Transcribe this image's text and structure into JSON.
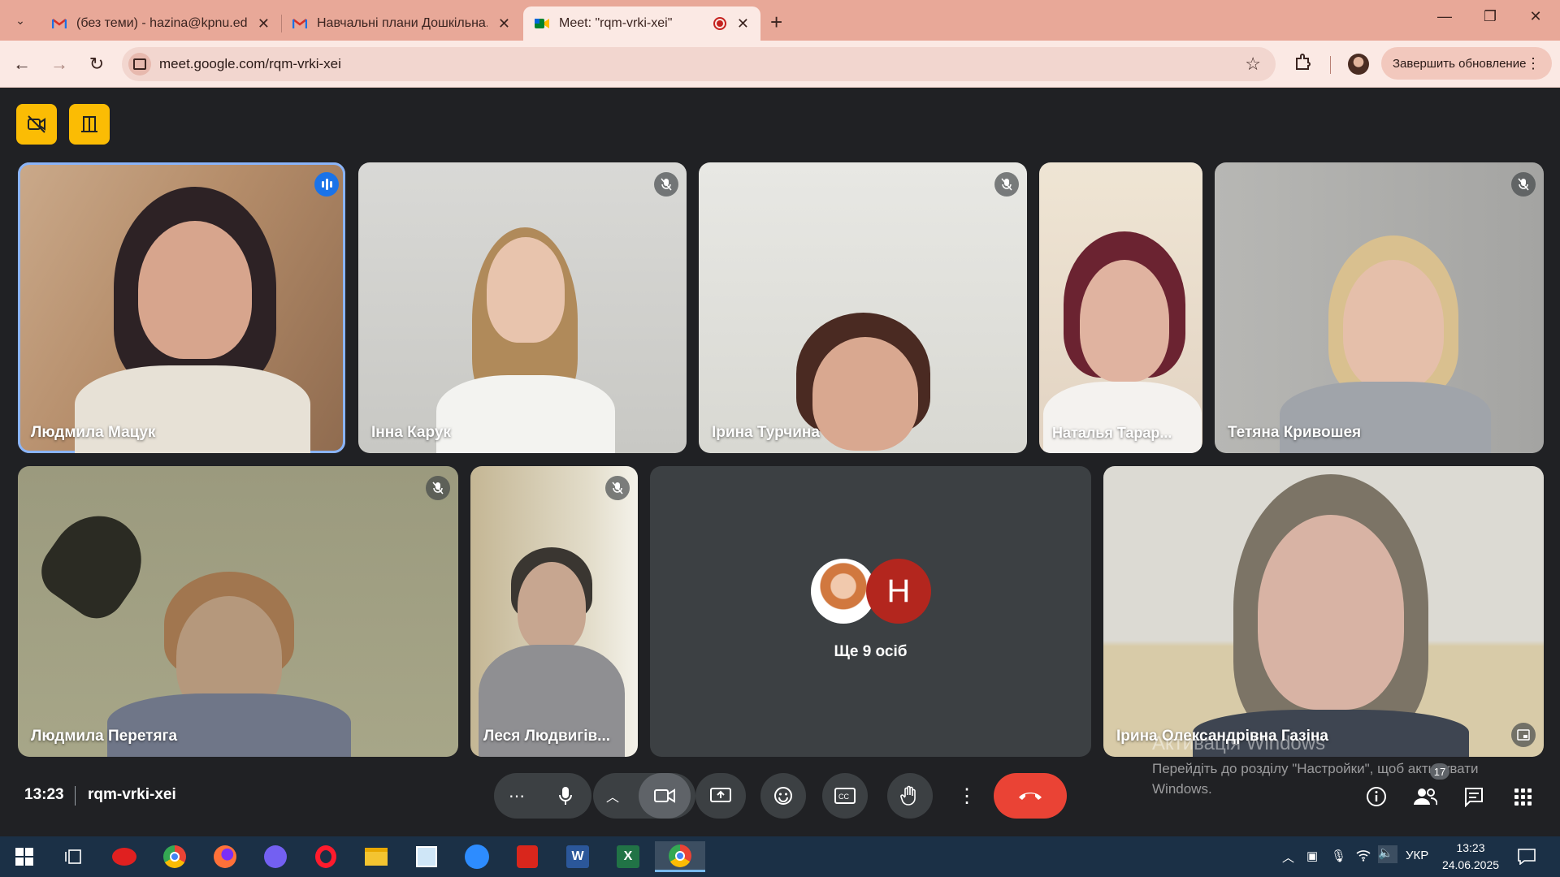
{
  "browser": {
    "tabs": [
      {
        "title": "(без теми) - hazina@kpnu.edu.ua",
        "icon": "gmail-icon",
        "active": false
      },
      {
        "title": "Навчальні плани Дошкільна. Логопедія",
        "icon": "gmail-icon",
        "active": false
      },
      {
        "title": "Meet: \"rqm-vrki-xei\"",
        "icon": "meet-icon",
        "active": true
      }
    ],
    "url": "meet.google.com/rqm-vrki-xei",
    "update_button": "Завершить обновление",
    "accent": "#e8a898"
  },
  "meet": {
    "host_controls": [
      "video-off-icon",
      "door-icon"
    ],
    "participants": [
      {
        "name": "Людмила Мацук",
        "speaking": true
      },
      {
        "name": "Інна Карук",
        "muted": true
      },
      {
        "name": "Ірина Турчина",
        "muted": true
      },
      {
        "name": "Наталья Тарар...",
        "muted": false
      },
      {
        "name": "Тетяна Кривошея",
        "muted": true
      },
      {
        "name": "Людмила Перетяга",
        "muted": true
      },
      {
        "name": "Леся Людвигів...",
        "muted": true
      },
      {
        "name": "Ірина Олександрівна Газіна",
        "muted": false
      }
    ],
    "others": {
      "avatar_letter": "H",
      "label": "Ще 9 осіб"
    },
    "watermark": {
      "title": "Активація Windows",
      "text": "Перейдіть до розділу \"Настройки\", щоб активувати Windows."
    },
    "bottom": {
      "time": "13:23",
      "code": "rqm-vrki-xei",
      "people_count": "17",
      "end_color": "#ea4335"
    }
  },
  "taskbar": {
    "language": "УКР",
    "time": "13:23",
    "date": "24.06.2025",
    "apps": [
      "start-icon",
      "task-view-icon",
      "kaspersky-icon",
      "chrome-icon",
      "firefox-icon",
      "viber-icon",
      "opera-icon",
      "file-explorer-icon",
      "notepad-icon",
      "zoom-icon",
      "acrobat-icon",
      "word-icon",
      "excel-icon",
      "chrome-active-icon"
    ]
  }
}
